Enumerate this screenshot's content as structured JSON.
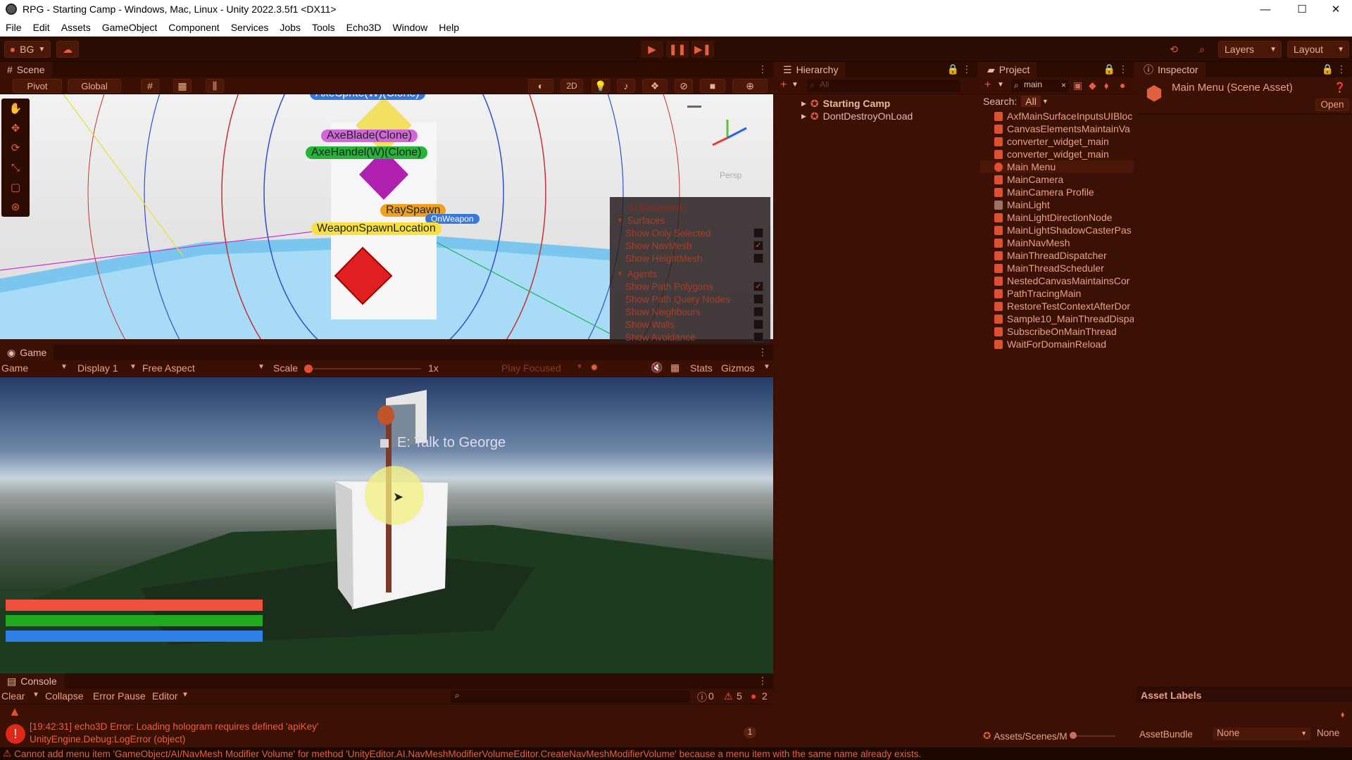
{
  "window": {
    "title": "RPG - Starting Camp - Windows, Mac, Linux - Unity 2022.3.5f1 <DX11>",
    "minimize": "—",
    "maximize": "☐",
    "close": "✕"
  },
  "menu": [
    "File",
    "Edit",
    "Assets",
    "GameObject",
    "Component",
    "Services",
    "Jobs",
    "Tools",
    "Echo3D",
    "Window",
    "Help"
  ],
  "toolbar": {
    "account": "BG",
    "layers": "Layers",
    "layout": "Layout"
  },
  "scene": {
    "tab": "Scene",
    "pivot": "Pivot",
    "global": "Global",
    "two_d": "2D",
    "persp": "Persp",
    "labels": {
      "axesprite": "AxeSprite(W)(Clone)",
      "axeblade": "AxeBlade(Clone)",
      "axehandel": "AxeHandel(W)(Clone)",
      "rayspawn": "RaySpawn",
      "onweapon": "OnWeapon",
      "weaponspawn": "WeaponSpawnLocation"
    },
    "ai_nav": {
      "title": "AI Navigation",
      "surfaces": "Surfaces",
      "surface_items": [
        {
          "label": "Show Only Selected",
          "checked": false
        },
        {
          "label": "Show NavMesh",
          "checked": true
        },
        {
          "label": "Show HeightMesh",
          "checked": false
        }
      ],
      "agents": "Agents",
      "agent_items": [
        {
          "label": "Show Path Polygons",
          "checked": true
        },
        {
          "label": "Show Path Query Nodes",
          "checked": false
        },
        {
          "label": "Show Neighbours",
          "checked": false
        },
        {
          "label": "Show Walls",
          "checked": false
        },
        {
          "label": "Show Avoidance",
          "checked": false
        }
      ]
    }
  },
  "game": {
    "tab": "Game",
    "mode": "Game",
    "display": "Display 1",
    "aspect": "Free Aspect",
    "scale_label": "Scale",
    "scale_value": "1x",
    "play_focused": "Play Focused",
    "stats": "Stats",
    "gizmos": "Gizmos",
    "prompt": "E: Talk to George",
    "bars": [
      {
        "name": "health",
        "color": "#f0503c",
        "fill": 1.0
      },
      {
        "name": "stamina",
        "color": "#1faa1f",
        "fill": 1.0
      },
      {
        "name": "mana",
        "color": "#2f80e8",
        "fill": 1.0
      }
    ]
  },
  "console": {
    "tab": "Console",
    "clear": "Clear",
    "collapse": "Collapse",
    "error_pause": "Error Pause",
    "editor": "Editor",
    "count_info": "0",
    "count_warn": "5",
    "count_error": "2",
    "entry_line1": "[19:42:31] echo3D Error: Loading hologram requires defined 'apiKey'",
    "entry_line2": "UnityEngine.Debug:LogError (object)",
    "entry_count": "1"
  },
  "hierarchy": {
    "tab": "Hierarchy",
    "search_placeholder": "All",
    "items": [
      "Starting Camp",
      "DontDestroyOnLoad"
    ]
  },
  "project": {
    "tab": "Project",
    "search_value": "main",
    "search_label": "Search:",
    "search_scope": "All",
    "assets": [
      "AxfMainSurfaceInputsUIBloc",
      "CanvasElementsMaintainVa",
      "converter_widget_main",
      "converter_widget_main",
      "Main Menu",
      "MainCamera",
      "MainCamera Profile",
      "MainLight",
      "MainLightDirectionNode",
      "MainLightShadowCasterPas",
      "MainNavMesh",
      "MainThreadDispatcher",
      "MainThreadScheduler",
      "NestedCanvasMaintainsCor",
      "PathTracingMain",
      "RestoreTestContextAfterDor",
      "Sample10_MainThreadDispa",
      "SubscribeOnMainThread",
      "WaitForDomainReload"
    ],
    "path": "Assets/Scenes/M"
  },
  "inspector": {
    "tab": "Inspector",
    "title": "Main Menu (Scene Asset)",
    "open": "Open",
    "asset_labels": "Asset Labels",
    "assetbundle_label": "AssetBundle",
    "assetbundle_value": "None",
    "assetbundle_variant": "None"
  },
  "status": "Cannot add menu item 'GameObject/AI/NavMesh Modifier Volume' for method 'UnityEditor.AI.NavMeshModifierVolumeEditor.CreateNavMeshModifierVolume' because a menu item with the same name already exists."
}
